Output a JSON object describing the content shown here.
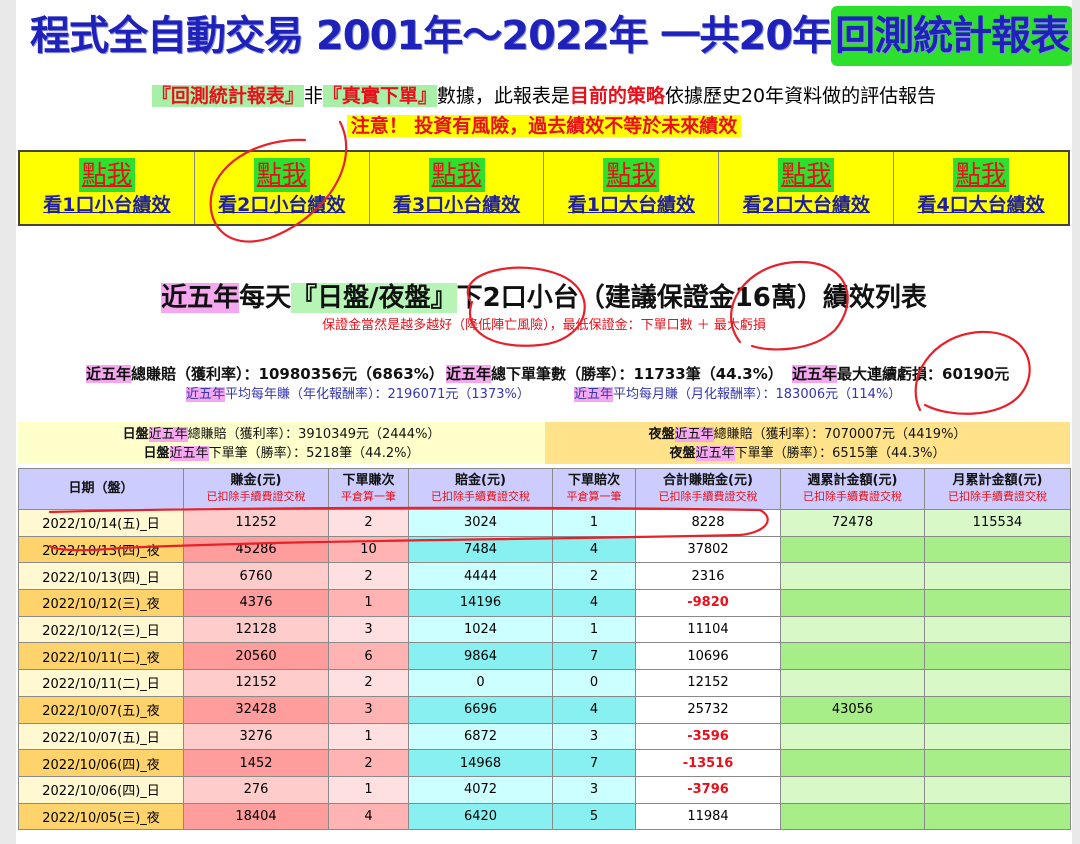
{
  "header": {
    "title_pre": "程式全自動交易 2001年～2022年 一共20年",
    "title_burst": "回測統計報表",
    "sub_q1": "『回測統計報表』",
    "sub_t1": "非",
    "sub_q2": "『真實下單』",
    "sub_t2": "數據，此報表是",
    "sub_q3": "目前的策略",
    "sub_t3": "依據歷史20年資料做的評估報告",
    "warning": "注意！ 投資有風險，過去績效不等於未來績效"
  },
  "links": [
    {
      "click": "點我",
      "label": "看1口小台績效"
    },
    {
      "click": "點我",
      "label": "看2口小台績效"
    },
    {
      "click": "點我",
      "label": "看3口小台績效"
    },
    {
      "click": "點我",
      "label": "看1口大台績效"
    },
    {
      "click": "點我",
      "label": "看2口大台績效"
    },
    {
      "click": "點我",
      "label": "看4口大台績效"
    }
  ],
  "section": {
    "p1": "近五年",
    "p2": "每天",
    "p3": "『日盤/夜盤』",
    "p4": "下2口小台（建議保證金16萬）績效列表",
    "note": "保證金當然是越多越好（降低陣亡風險），最低保證金：下單口數 ＋ 最大虧損"
  },
  "stats": {
    "tag": "近五年",
    "profit": "總賺賠（獲利率）：10980356元（6863%）",
    "orders": "總下單筆數（勝率）：11733筆（44.3%）",
    "maxloss": "最大連續虧損：60190元",
    "yearly": "平均每年賺（年化報酬率）：2196071元（1373%）",
    "monthly": "平均每月賺（月化報酬率）：183006元（114%）"
  },
  "bands": {
    "day_tag": "日盤",
    "night_tag": "夜盤",
    "five": "近五年",
    "day_profit": "總賺賠（獲利率）：3910349元（2444%）",
    "day_orders": "下單筆（勝率）：5218筆（44.2%）",
    "night_profit": "總賺賠（獲利率）：7070007元（4419%）",
    "night_orders": "下單筆（勝率）：6515筆（44.3%）"
  },
  "table": {
    "headers": [
      {
        "main": "日期（盤）",
        "sub": ""
      },
      {
        "main": "賺金(元)",
        "sub": "已扣除手續費證交稅"
      },
      {
        "main": "下單賺次",
        "sub": "平倉算一筆"
      },
      {
        "main": "賠金(元)",
        "sub": "已扣除手續費證交稅"
      },
      {
        "main": "下單賠次",
        "sub": "平倉算一筆"
      },
      {
        "main": "合計賺賠金(元)",
        "sub": "已扣除手續費證交稅"
      },
      {
        "main": "週累計金額(元)",
        "sub": "已扣除手續費證交稅"
      },
      {
        "main": "月累計金額(元)",
        "sub": "已扣除手續費證交稅"
      }
    ],
    "rows": [
      {
        "date": "2022/10/14(五)_日",
        "win": "11252",
        "wcnt": "2",
        "loss": "3024",
        "lcnt": "1",
        "total": "8228",
        "week": "72478",
        "month": "115534"
      },
      {
        "date": "2022/10/13(四)_夜",
        "win": "45286",
        "wcnt": "10",
        "loss": "7484",
        "lcnt": "4",
        "total": "37802",
        "week": "",
        "month": ""
      },
      {
        "date": "2022/10/13(四)_日",
        "win": "6760",
        "wcnt": "2",
        "loss": "4444",
        "lcnt": "2",
        "total": "2316",
        "week": "",
        "month": ""
      },
      {
        "date": "2022/10/12(三)_夜",
        "win": "4376",
        "wcnt": "1",
        "loss": "14196",
        "lcnt": "4",
        "total": "-9820",
        "week": "",
        "month": ""
      },
      {
        "date": "2022/10/12(三)_日",
        "win": "12128",
        "wcnt": "3",
        "loss": "1024",
        "lcnt": "1",
        "total": "11104",
        "week": "",
        "month": ""
      },
      {
        "date": "2022/10/11(二)_夜",
        "win": "20560",
        "wcnt": "6",
        "loss": "9864",
        "lcnt": "7",
        "total": "10696",
        "week": "",
        "month": ""
      },
      {
        "date": "2022/10/11(二)_日",
        "win": "12152",
        "wcnt": "2",
        "loss": "0",
        "lcnt": "0",
        "total": "12152",
        "week": "",
        "month": ""
      },
      {
        "date": "2022/10/07(五)_夜",
        "win": "32428",
        "wcnt": "3",
        "loss": "6696",
        "lcnt": "4",
        "total": "25732",
        "week": "43056",
        "month": ""
      },
      {
        "date": "2022/10/07(五)_日",
        "win": "3276",
        "wcnt": "1",
        "loss": "6872",
        "lcnt": "3",
        "total": "-3596",
        "week": "",
        "month": ""
      },
      {
        "date": "2022/10/06(四)_夜",
        "win": "1452",
        "wcnt": "2",
        "loss": "14968",
        "lcnt": "7",
        "total": "-13516",
        "week": "",
        "month": ""
      },
      {
        "date": "2022/10/06(四)_日",
        "win": "276",
        "wcnt": "1",
        "loss": "4072",
        "lcnt": "3",
        "total": "-3796",
        "week": "",
        "month": ""
      },
      {
        "date": "2022/10/05(三)_夜",
        "win": "18404",
        "wcnt": "4",
        "loss": "6420",
        "lcnt": "5",
        "total": "11984",
        "week": "",
        "month": ""
      }
    ]
  },
  "colors": {
    "title_blue": "#1f22b8",
    "alert_red": "#e8101a",
    "highlight_yellow": "#ffff00",
    "burst_green": "#2ee02e",
    "annotation_red": "#e8202a"
  }
}
